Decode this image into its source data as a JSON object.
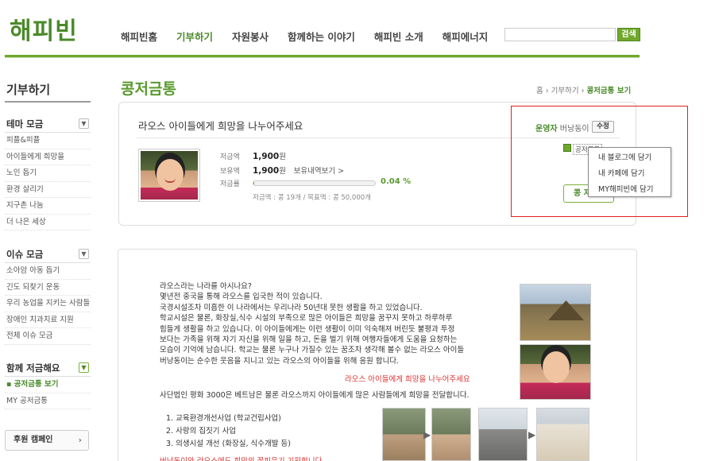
{
  "header": {
    "logo": "해피빈",
    "nav": [
      "해피빈홈",
      "기부하기",
      "자원봉사",
      "함께하는 이야기",
      "해피빈 소개",
      "해피에너지"
    ],
    "active_nav_index": 1,
    "search_placeholder": "",
    "search_button": "검색"
  },
  "sidebar": {
    "title": "기부하기",
    "groups": [
      {
        "title": "테마 모금",
        "items": [
          "피플&피플",
          "아이들에게 희망을",
          "노인 돕기",
          "환경 살리기",
          "지구촌 나눔",
          "더 나은 세상"
        ]
      },
      {
        "title": "이슈 모금",
        "items": [
          "소아암 아동 돕기",
          "긴도 되찾기 운동",
          "우리 농업을 지키는 사람들",
          "장애인 치과치료 지원",
          "전체 이슈 모금"
        ]
      },
      {
        "title": "함께 저금해요",
        "items": [
          "▪ 공저금통 보기",
          "MY 공저금통"
        ],
        "active_index": 0
      }
    ],
    "campaign_button": "후원 캠페인"
  },
  "main": {
    "page_title": "콩저금통",
    "breadcrumb": [
      "홈",
      "기부하기",
      "콩저금통 보기"
    ],
    "card": {
      "title": "라오스 아이들에게 희망을 나누어주세요",
      "admin_label": "운영자",
      "admin_name": "버낭동이",
      "edit_button": "수정",
      "stats": {
        "saved_label": "저금액",
        "saved_value": "1,900",
        "saved_unit": "원",
        "owned_label": "보유액",
        "owned_value": "1,900",
        "owned_unit": "원",
        "owned_link": "보유내역보기 >",
        "rate_label": "저금률",
        "rate_value": "0.04 %",
        "progress": 0.0004,
        "summary": "저금액 : 콩 19개  /  목표액 : 콩 50,000개"
      },
      "share_label": "공저금통",
      "donate_button": "콩 저금",
      "share_menu": [
        "내 블로그에 담기",
        "내 카페에 담기",
        "MY해피빈에 담기"
      ]
    },
    "story": {
      "lines": [
        "라오스라는 나라를 아시나요?",
        "몇년전 중국을 통해 라오스를 입국한 적이 있습니다.",
        "국경시설조차 미흡한 이 나라에서는 우리나라 50년대 못한 생활을 하고 있었습니다.",
        "학교시설은 물론, 화장실,식수 시설의 부족으로 많은 아이들은 희망을 꿈꾸지 못하고 하루하루",
        "힘들게 생활을 하고 있습니다. 이 아이들에게는 이런 생활이 이미 익숙해져 버린듯 불평과 투정",
        "보다는 가족을 위해 자기 자신을 위해 일을 하고, 돈을 벌기 위해 여행자들에게 도움을 요청하는",
        "모습이 기억에 남습니다. 학교는 물론 누구나 가질수 있는 꿈조차 생각해 볼수 없는 라오스 아이들",
        "버낭동이는 순수한 웃음을 지니고 있는 라오스의 아이들을 위해 응원 합니다."
      ],
      "red_line": "라오스 아이들에게 희망을 나누어주세요",
      "line2": "사단법인 평화 3000은 베트남은 물론 라오스까지 아이들에게 많은 사람들에게 희망을 전달합니다.",
      "list": [
        "1. 교육환경개선사업 (학교건립사업)",
        "2. 사랑의 집짓기 사업",
        "3. 의생시설 개선 (화장실, 식수개발 등)"
      ],
      "red_line2": "버낭동이와 라오스에도 희망의 꽃피우기 기원합니다."
    }
  }
}
